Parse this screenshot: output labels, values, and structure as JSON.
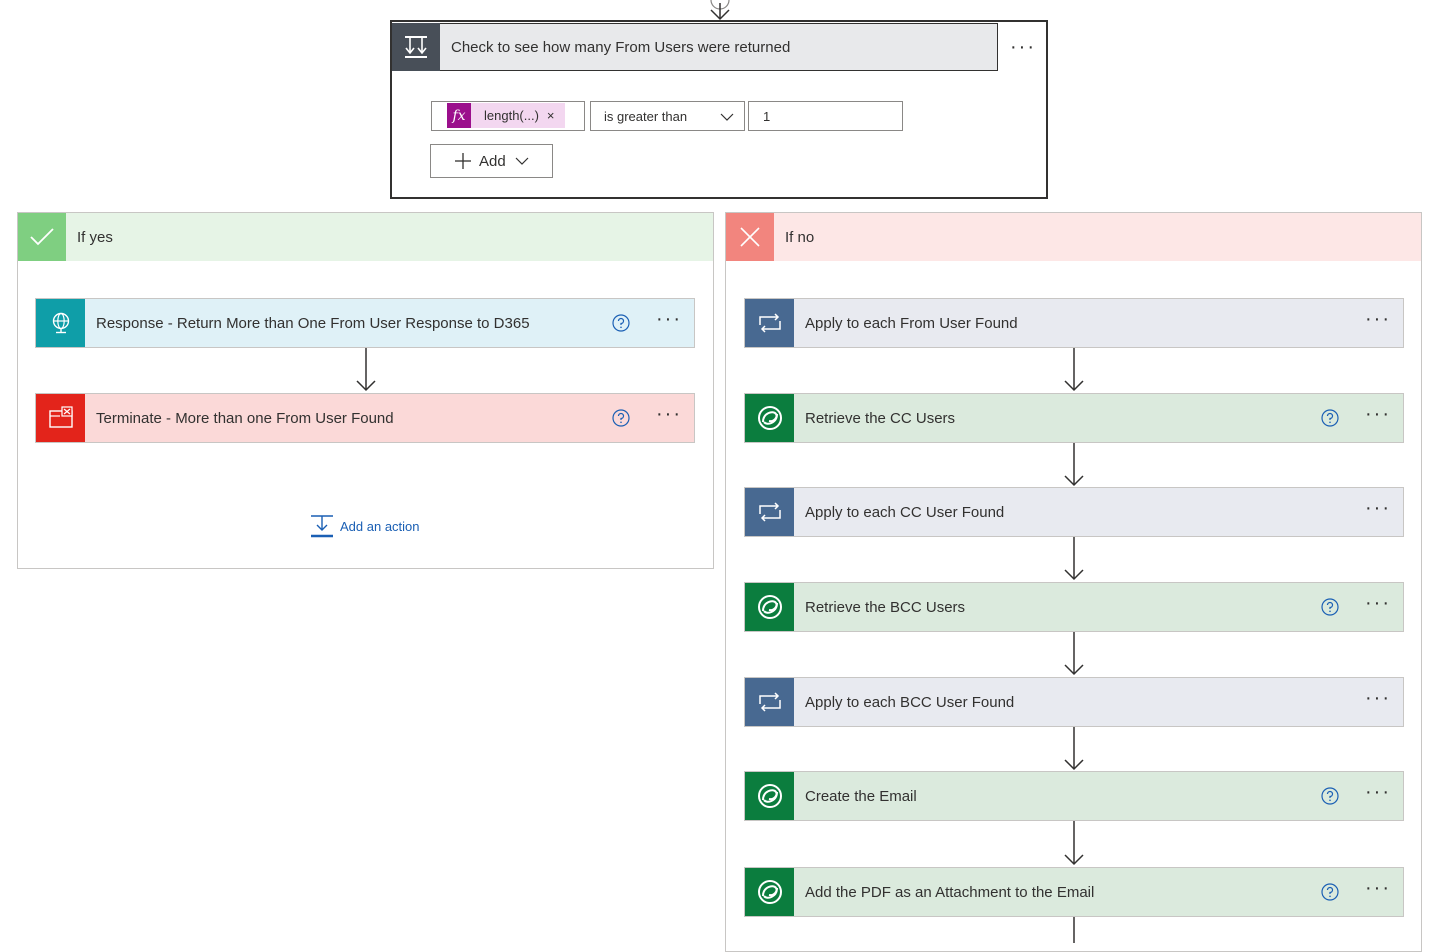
{
  "condition": {
    "title": "Check to see how many From Users were returned",
    "more": "···",
    "token_label": "length(...)",
    "token_remove": "×",
    "operator": "is greater than",
    "value": "1",
    "add_label": "Add"
  },
  "yes_branch": {
    "title": "If yes",
    "actions": [
      {
        "title": "Response - Return More than One From User Response to D365",
        "more": "···"
      },
      {
        "title": "Terminate - More than one From User Found",
        "more": "···"
      }
    ],
    "add_action": "Add an action"
  },
  "no_branch": {
    "title": "If no",
    "actions": [
      {
        "title": "Apply to each From User Found",
        "more": "···"
      },
      {
        "title": "Retrieve the CC Users",
        "more": "···"
      },
      {
        "title": "Apply to each CC User Found",
        "more": "···"
      },
      {
        "title": "Retrieve the BCC Users",
        "more": "···"
      },
      {
        "title": "Apply to each BCC User Found",
        "more": "···"
      },
      {
        "title": "Create the Email",
        "more": "···"
      },
      {
        "title": "Add the PDF as an Attachment to the Email",
        "more": "···"
      }
    ]
  },
  "colors": {
    "yes_header": "#e6f4e6",
    "yes_icon": "#7fcf81",
    "no_header": "#fde7e6",
    "no_icon": "#f2857e",
    "response_bg": "#dff1f7",
    "response_icon": "#0f9ea8",
    "terminate_bg": "#fbd9d8",
    "terminate_icon": "#e3241b",
    "loop_bg": "#e8eaf0",
    "loop_icon": "#486991",
    "dataverse_bg": "#dbeadd",
    "dataverse_icon": "#0b7d3e",
    "link": "#1a5fb4"
  }
}
